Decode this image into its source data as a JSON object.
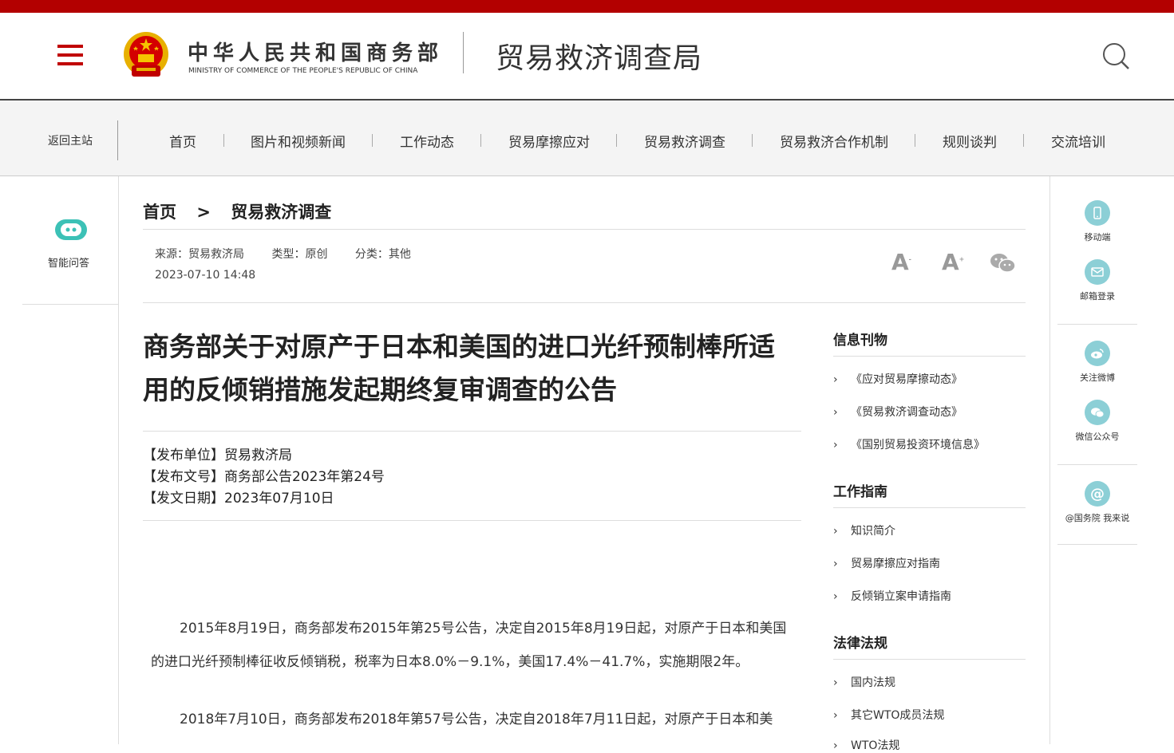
{
  "header": {
    "ministry_cn": "中华人民共和国商务部",
    "ministry_en": "MINISTRY OF COMMERCE OF THE PEOPLE'S REPUBLIC OF CHINA",
    "bureau": "贸易救济调查局",
    "brand_color": "#b30000"
  },
  "nav": {
    "back_home": "返回主站",
    "items": [
      "首页",
      "图片和视频新闻",
      "工作动态",
      "贸易摩擦应对",
      "贸易救济调查",
      "贸易救济合作机制",
      "规则谈判",
      "交流培训"
    ]
  },
  "left": {
    "ai_label": "智能问答"
  },
  "right": {
    "items": [
      "移动端",
      "邮箱登录",
      "关注微博",
      "微信公众号",
      "@国务院 我来说"
    ],
    "accent": "#8ccfd6"
  },
  "breadcrumb": {
    "home": "首页",
    "sep": ">",
    "current": "贸易救济调查"
  },
  "meta": {
    "source": "来源：贸易救济局",
    "type": "类型：原创",
    "category": "分类：其他",
    "date": "2023-07-10 14:48",
    "font_small": "A",
    "font_large": "A"
  },
  "article": {
    "title": "商务部关于对原产于日本和美国的进口光纤预制棒所适用的反倾销措施发起期终复审调查的公告",
    "pub_unit": "【发布单位】贸易救济局",
    "pub_no": "【发布文号】商务部公告2023年第24号",
    "pub_date": "【发文日期】2023年07月10日",
    "para1": "2015年8月19日，商务部发布2015年第25号公告，决定自2015年8月19日起，对原产于日本和美国的进口光纤预制棒征收反倾销税，税率为日本8.0%－9.1%，美国17.4%－41.7%，实施期限2年。",
    "para2": "2018年7月10日，商务部发布2018年第57号公告，决定自2018年7月11日起，对原产于日本和美"
  },
  "sidebar": {
    "sections": [
      {
        "title": "信息刊物",
        "items": [
          "《应对贸易摩擦动态》",
          "《贸易救济调查动态》",
          "《国别贸易投资环境信息》"
        ]
      },
      {
        "title": "工作指南",
        "items": [
          "知识简介",
          "贸易摩擦应对指南",
          "反倾销立案申请指南"
        ]
      },
      {
        "title": "法律法规",
        "items": [
          "国内法规",
          "其它WTO成员法规",
          "WTO法规"
        ]
      }
    ]
  }
}
